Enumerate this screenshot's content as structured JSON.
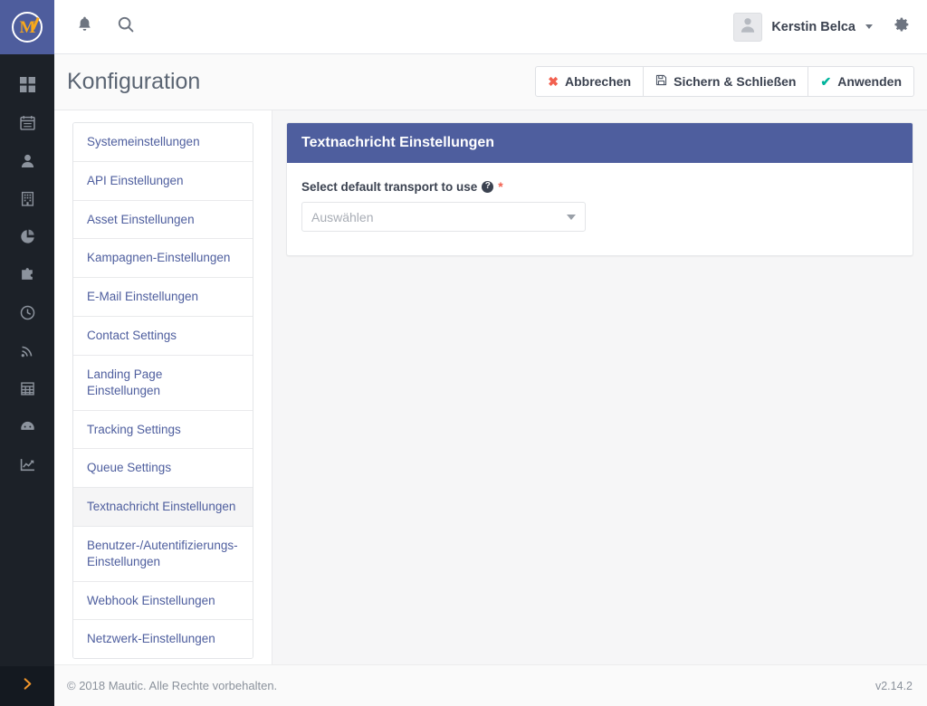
{
  "app": {
    "logo_letter": "M",
    "logo_name": "mautic-logo"
  },
  "topbar": {
    "notifications_icon": "bell-icon",
    "search_icon": "search-icon",
    "user_name": "Kerstin Belca",
    "avatar_icon": "user-avatar-icon",
    "settings_icon": "gear-icon"
  },
  "page": {
    "title": "Konfiguration"
  },
  "header_actions": {
    "cancel_label": "Abbrechen",
    "cancel_icon": "✖",
    "save_close_label": "Sichern & Schließen",
    "save_close_icon": "💾",
    "apply_label": "Anwenden",
    "apply_icon": "✔"
  },
  "config_nav": {
    "items": [
      {
        "label": "Systemeinstellungen",
        "active": false
      },
      {
        "label": "API Einstellungen",
        "active": false
      },
      {
        "label": "Asset Einstellungen",
        "active": false
      },
      {
        "label": "Kampagnen-Einstellungen",
        "active": false
      },
      {
        "label": "E-Mail Einstellungen",
        "active": false
      },
      {
        "label": "Contact Settings",
        "active": false
      },
      {
        "label": "Landing Page Einstellungen",
        "active": false
      },
      {
        "label": "Tracking Settings",
        "active": false
      },
      {
        "label": "Queue Settings",
        "active": false
      },
      {
        "label": "Textnachricht Einstellungen",
        "active": true
      },
      {
        "label": "Benutzer-/Autentifizierungs-Einstellungen",
        "active": false
      },
      {
        "label": "Webhook Einstellungen",
        "active": false
      },
      {
        "label": "Netzwerk-Einstellungen",
        "active": false
      }
    ]
  },
  "panel": {
    "title": "Textnachricht Einstellungen",
    "field_label": "Select default transport to use",
    "help_glyph": "?",
    "required_marker": "*",
    "select_placeholder": "Auswählen"
  },
  "rail": {
    "items": [
      {
        "icon": "dashboard-icon"
      },
      {
        "icon": "calendar-icon"
      },
      {
        "icon": "contacts-icon"
      },
      {
        "icon": "company-icon"
      },
      {
        "icon": "pie-chart-icon"
      },
      {
        "icon": "puzzle-icon"
      },
      {
        "icon": "clock-icon"
      },
      {
        "icon": "rss-icon"
      },
      {
        "icon": "table-icon"
      },
      {
        "icon": "gauge-icon"
      },
      {
        "icon": "line-chart-icon"
      }
    ],
    "toggle_icon": "chevron-right-icon"
  },
  "footer": {
    "copyright": "© 2018 Mautic. Alle Rechte vorbehalten.",
    "version": "v2.14.2"
  },
  "colors": {
    "brand_indigo": "#4e5e9e",
    "rail_dark": "#1c2128",
    "accent_orange": "#f0952b",
    "danger": "#f2604f",
    "success": "#00b49c"
  }
}
